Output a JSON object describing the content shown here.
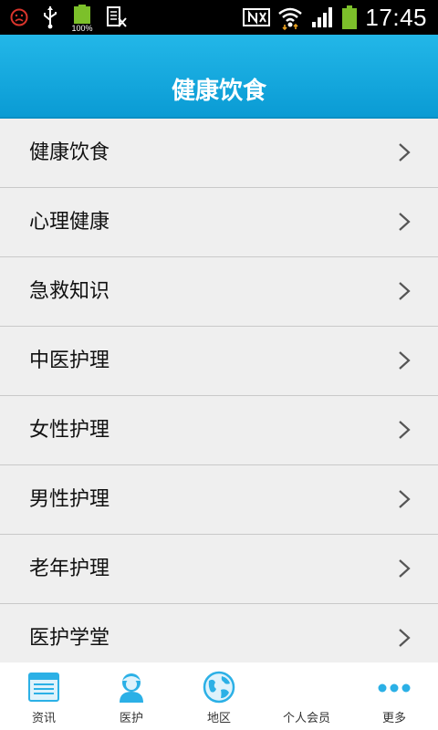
{
  "status_bar": {
    "time": "17:45",
    "battery_percent_label": "100%",
    "icons": [
      "notification-error-icon",
      "usb-icon",
      "battery-full-icon",
      "keyboard-icon",
      "nfc-icon",
      "wifi-icon",
      "signal-icon",
      "battery-icon"
    ]
  },
  "header": {
    "title": "健康饮食"
  },
  "list": {
    "items": [
      {
        "label": "健康饮食"
      },
      {
        "label": "心理健康"
      },
      {
        "label": "急救知识"
      },
      {
        "label": "中医护理"
      },
      {
        "label": "女性护理"
      },
      {
        "label": "男性护理"
      },
      {
        "label": "老年护理"
      },
      {
        "label": "医护学堂"
      }
    ]
  },
  "tabbar": {
    "tabs": [
      {
        "label": "资讯",
        "icon": "news-icon"
      },
      {
        "label": "医护",
        "icon": "nurse-icon"
      },
      {
        "label": "地区",
        "icon": "globe-icon"
      },
      {
        "label": "个人会员",
        "icon": "member-icon"
      },
      {
        "label": "更多",
        "icon": "more-icon"
      }
    ]
  },
  "colors": {
    "header": "#0fa8dd",
    "accent_icon": "#2bb0e6",
    "list_bg": "#efefef",
    "tabbar_bg": "#ffffff"
  }
}
